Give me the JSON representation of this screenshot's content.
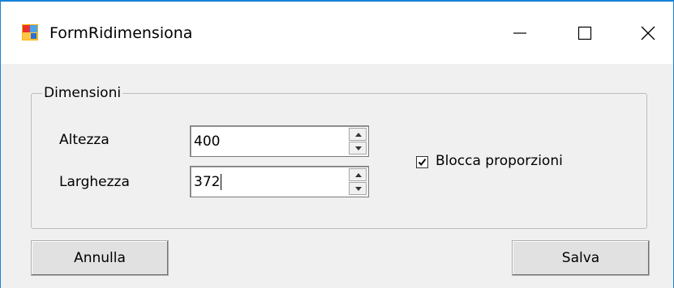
{
  "window": {
    "title": "FormRidimensiona",
    "icon": "form-app-icon",
    "controls": {
      "minimize": "minimize-icon",
      "maximize": "maximize-icon",
      "close": "close-icon"
    }
  },
  "group": {
    "legend": "Dimensioni",
    "altezza_label": "Altezza",
    "altezza_value": "400",
    "larghezza_label": "Larghezza",
    "larghezza_value": "372",
    "lock_label": "Blocca proporzioni",
    "lock_checked": true
  },
  "buttons": {
    "cancel": "Annulla",
    "save": "Salva"
  },
  "colors": {
    "window_border": "#1883d7",
    "client_bg": "#f0f0f0",
    "button_bg": "#e1e1e1"
  }
}
